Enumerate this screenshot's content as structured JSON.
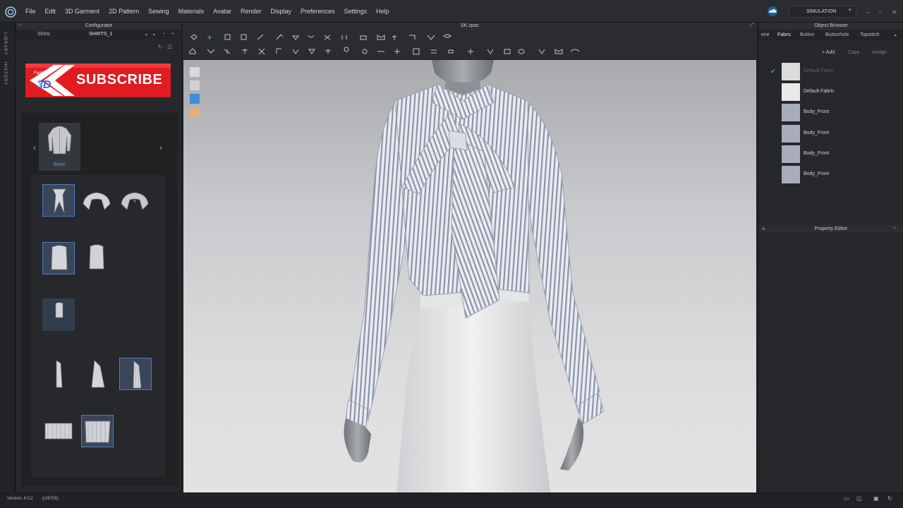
{
  "menubar": {
    "items": [
      "File",
      "Edit",
      "3D Garment",
      "2D Pattern",
      "Sewing",
      "Materials",
      "Avatar",
      "Render",
      "Display",
      "Preferences",
      "Settings",
      "Help"
    ],
    "simulation_label": "SIMULATION"
  },
  "left_tabs": [
    "LIBRARY",
    "HISTORY"
  ],
  "configurator": {
    "title": "Configurator",
    "tabs": [
      "Shirts",
      "SHIRTS_1"
    ],
    "category_label": "Basic",
    "subscribe_banner": {
      "brand": "Fashion",
      "brand_3d": "3D",
      "label": "SUBSCRIBE"
    }
  },
  "viewport": {
    "title": "SK.zpac"
  },
  "object_browser": {
    "title": "Object Browser",
    "tabs": [
      "ene",
      "Fabric",
      "Button",
      "Buttonhole",
      "Topstitch"
    ],
    "actions": [
      "+ Add",
      "Copy",
      "Assign"
    ],
    "fabrics": [
      {
        "name": "Default Fabric",
        "dimmed": true,
        "checked": true
      },
      {
        "name": "Default Fabric",
        "dimmed": false,
        "checked": false
      },
      {
        "name": "Body_Front",
        "dimmed": false,
        "checked": false
      },
      {
        "name": "Body_Front",
        "dimmed": false,
        "checked": false
      },
      {
        "name": "Body_Front",
        "dimmed": false,
        "checked": false
      },
      {
        "name": "Body_Front",
        "dimmed": false,
        "checked": false
      }
    ]
  },
  "property_editor": {
    "title": "Property Editor"
  },
  "status": {
    "version": "Version: 4.0.2",
    "build": "(r26705)"
  },
  "colors": {
    "accent": "#4f9cf0",
    "banner_red": "#e11b22",
    "selection": "#3a4658"
  }
}
